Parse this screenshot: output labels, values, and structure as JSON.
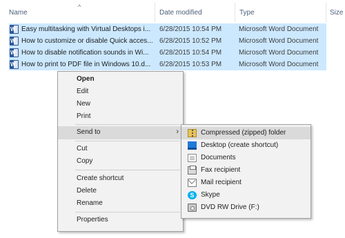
{
  "columns": {
    "name": "Name",
    "date_modified": "Date modified",
    "type": "Type",
    "size": "Size",
    "sort_indicator": "^"
  },
  "files": [
    {
      "name": "Easy multitasking with Virtual Desktops i...",
      "date": "6/28/2015 10:54 PM",
      "type": "Microsoft Word Document",
      "icon": "word-doc-icon",
      "selected": true
    },
    {
      "name": "How to customize or disable Quick acces...",
      "date": "6/28/2015 10:52 PM",
      "type": "Microsoft Word Document",
      "icon": "word-doc-icon",
      "selected": true
    },
    {
      "name": "How to disable notification sounds in Wi...",
      "date": "6/28/2015 10:54 PM",
      "type": "Microsoft Word Document",
      "icon": "word-doc-icon",
      "selected": true
    },
    {
      "name": "How to print to PDF file in Windows 10.d...",
      "date": "6/28/2015 10:53 PM",
      "type": "Microsoft Word Document",
      "icon": "word-doc-icon",
      "selected": true
    }
  ],
  "context_menu": {
    "open": "Open",
    "edit": "Edit",
    "new": "New",
    "print": "Print",
    "send_to": "Send to",
    "send_to_arrow": "›",
    "cut": "Cut",
    "copy": "Copy",
    "create_shortcut": "Create shortcut",
    "delete": "Delete",
    "rename": "Rename",
    "properties": "Properties"
  },
  "send_to_menu": [
    {
      "label": "Compressed (zipped) folder",
      "icon": "zip-folder-icon",
      "highlighted": true
    },
    {
      "label": "Desktop (create shortcut)",
      "icon": "desktop-icon"
    },
    {
      "label": "Documents",
      "icon": "documents-icon"
    },
    {
      "label": "Fax recipient",
      "icon": "fax-icon"
    },
    {
      "label": "Mail recipient",
      "icon": "mail-icon"
    },
    {
      "label": "Skype",
      "icon": "skype-icon"
    },
    {
      "label": "DVD RW Drive (F:)",
      "icon": "dvd-drive-icon"
    }
  ],
  "colors": {
    "selection": "#cce8ff",
    "menu_bg": "#f2f2f2",
    "menu_hover": "#dadada",
    "header_text": "#4c607a",
    "word_blue": "#2b579a"
  }
}
